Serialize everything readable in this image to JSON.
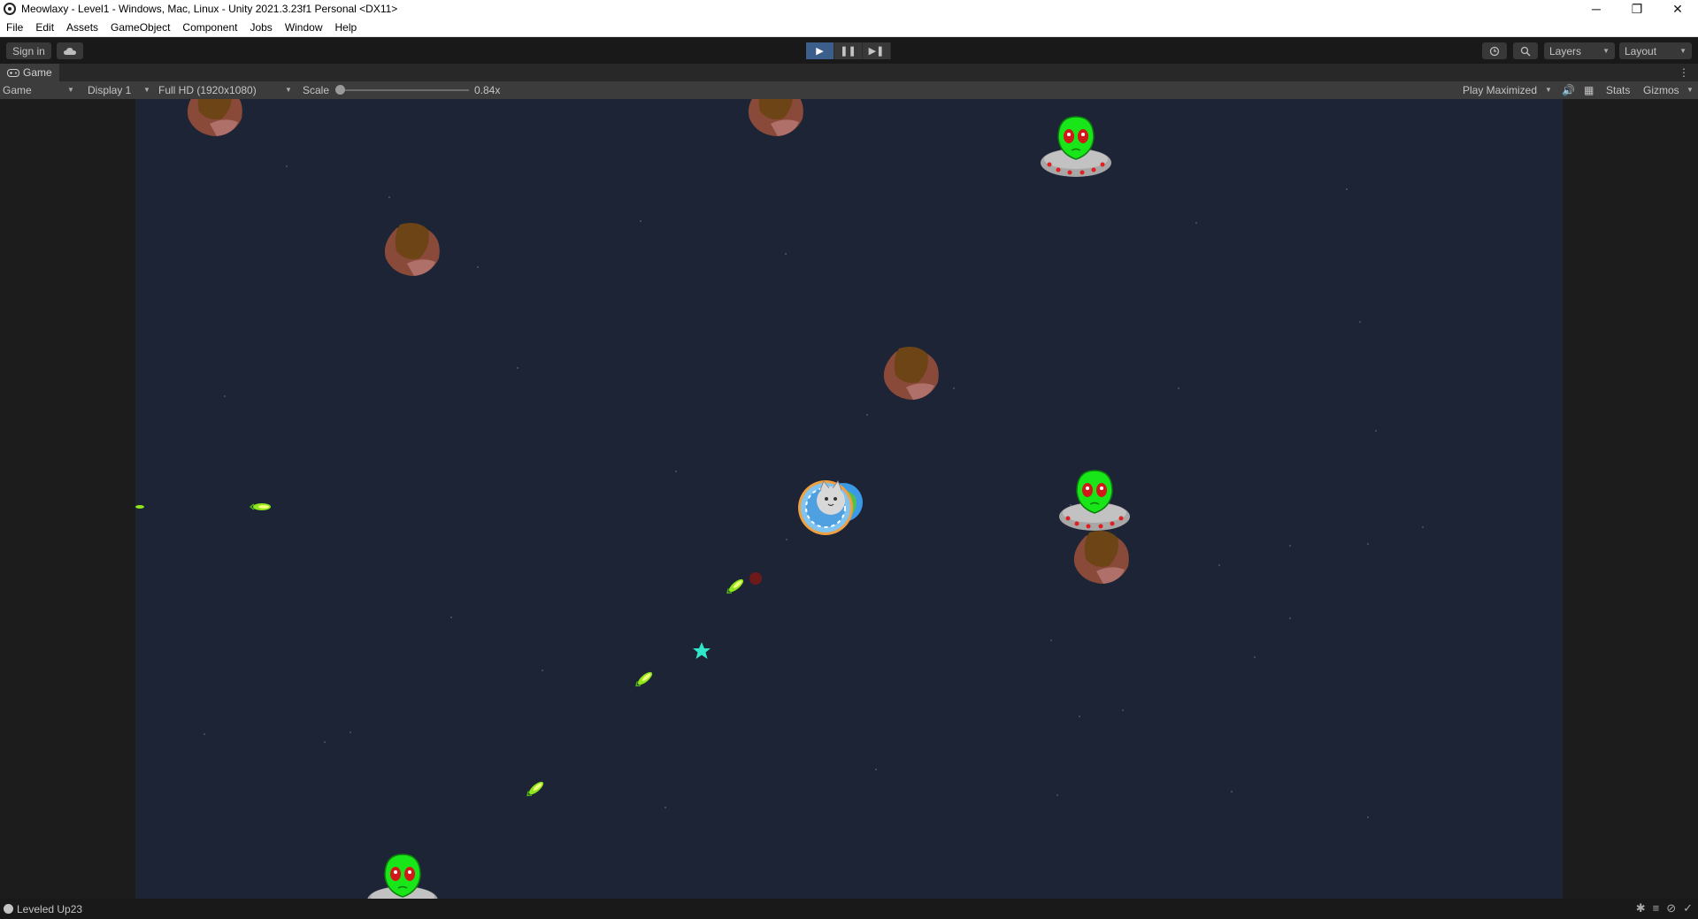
{
  "window": {
    "title": "Meowlaxy - Level1 - Windows, Mac, Linux - Unity 2021.3.23f1 Personal <DX11>",
    "controls": [
      "─",
      "❐",
      "✕"
    ]
  },
  "menu": [
    "File",
    "Edit",
    "Assets",
    "GameObject",
    "Component",
    "Jobs",
    "Window",
    "Help"
  ],
  "toolbar": {
    "sign_in": "Sign in",
    "play_icons": [
      "▶",
      "❚❚",
      "▶❚"
    ],
    "layers": "Layers",
    "layout": "Layout"
  },
  "tab": {
    "label": "Game"
  },
  "gamebar": {
    "view_select": "Game",
    "display_select": "Display 1",
    "resolution_select": "Full HD (1920x1080)",
    "scale_label": "Scale",
    "scale_value": "0.84x",
    "play_mode": "Play Maximized",
    "stats": "Stats",
    "gizmos": "Gizmos"
  },
  "status": {
    "message": "Leveled Up23"
  },
  "colors": {
    "space_bg": "#1d2436",
    "alien_green": "#19e619",
    "asteroid_brown": "#7a4a2a",
    "star_cyan": "#30e8c8",
    "play_active": "#3b5f8a"
  }
}
